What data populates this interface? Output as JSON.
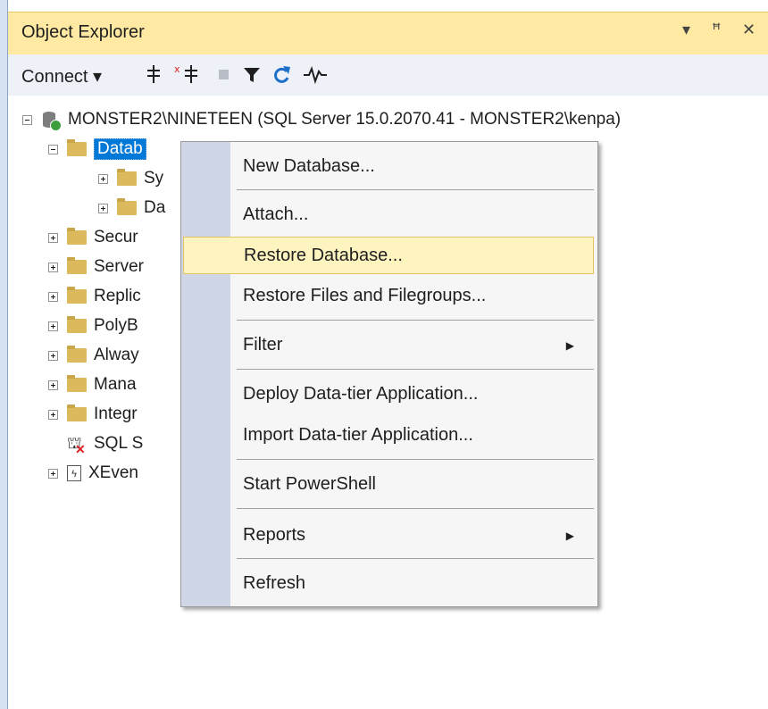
{
  "panel": {
    "title": "Object Explorer",
    "controls": [
      "▾",
      "ꟸ",
      "✕"
    ]
  },
  "toolbar": {
    "connect_label": "Connect ▾",
    "icons": [
      "connect-icon",
      "disconnect-icon",
      "stop-icon",
      "filter-icon",
      "refresh-icon",
      "activity-monitor-icon"
    ]
  },
  "tree": {
    "server_label": "MONSTER2\\NINETEEN (SQL Server 15.0.2070.41 - MONSTER2\\kenpa)",
    "items": [
      {
        "label": "Datab",
        "selected": true
      },
      {
        "label": "Sy"
      },
      {
        "label": "Da"
      },
      {
        "label": "Secur"
      },
      {
        "label": "Server"
      },
      {
        "label": "Replic"
      },
      {
        "label": "PolyB"
      },
      {
        "label": "Alway"
      },
      {
        "label": "Mana"
      },
      {
        "label": "Integr"
      },
      {
        "label": "SQL S"
      },
      {
        "label": "XEven"
      }
    ]
  },
  "context_menu": {
    "items": [
      {
        "label": "New Database..."
      },
      {
        "label": "Attach..."
      },
      {
        "label": "Restore Database...",
        "highlighted": true
      },
      {
        "label": "Restore Files and Filegroups..."
      },
      {
        "label": "Filter",
        "submenu": true
      },
      {
        "label": "Deploy Data-tier Application..."
      },
      {
        "label": "Import Data-tier Application..."
      },
      {
        "label": "Start PowerShell"
      },
      {
        "label": "Reports",
        "submenu": true
      },
      {
        "label": "Refresh"
      }
    ],
    "submenu_arrow": "▶"
  },
  "colors": {
    "header_bg": "#ffe9a3",
    "selection": "#0078d7",
    "menu_highlight": "#fdf4bf",
    "menu_gutter": "#cfd7e6",
    "folder": "#dcb95c"
  }
}
